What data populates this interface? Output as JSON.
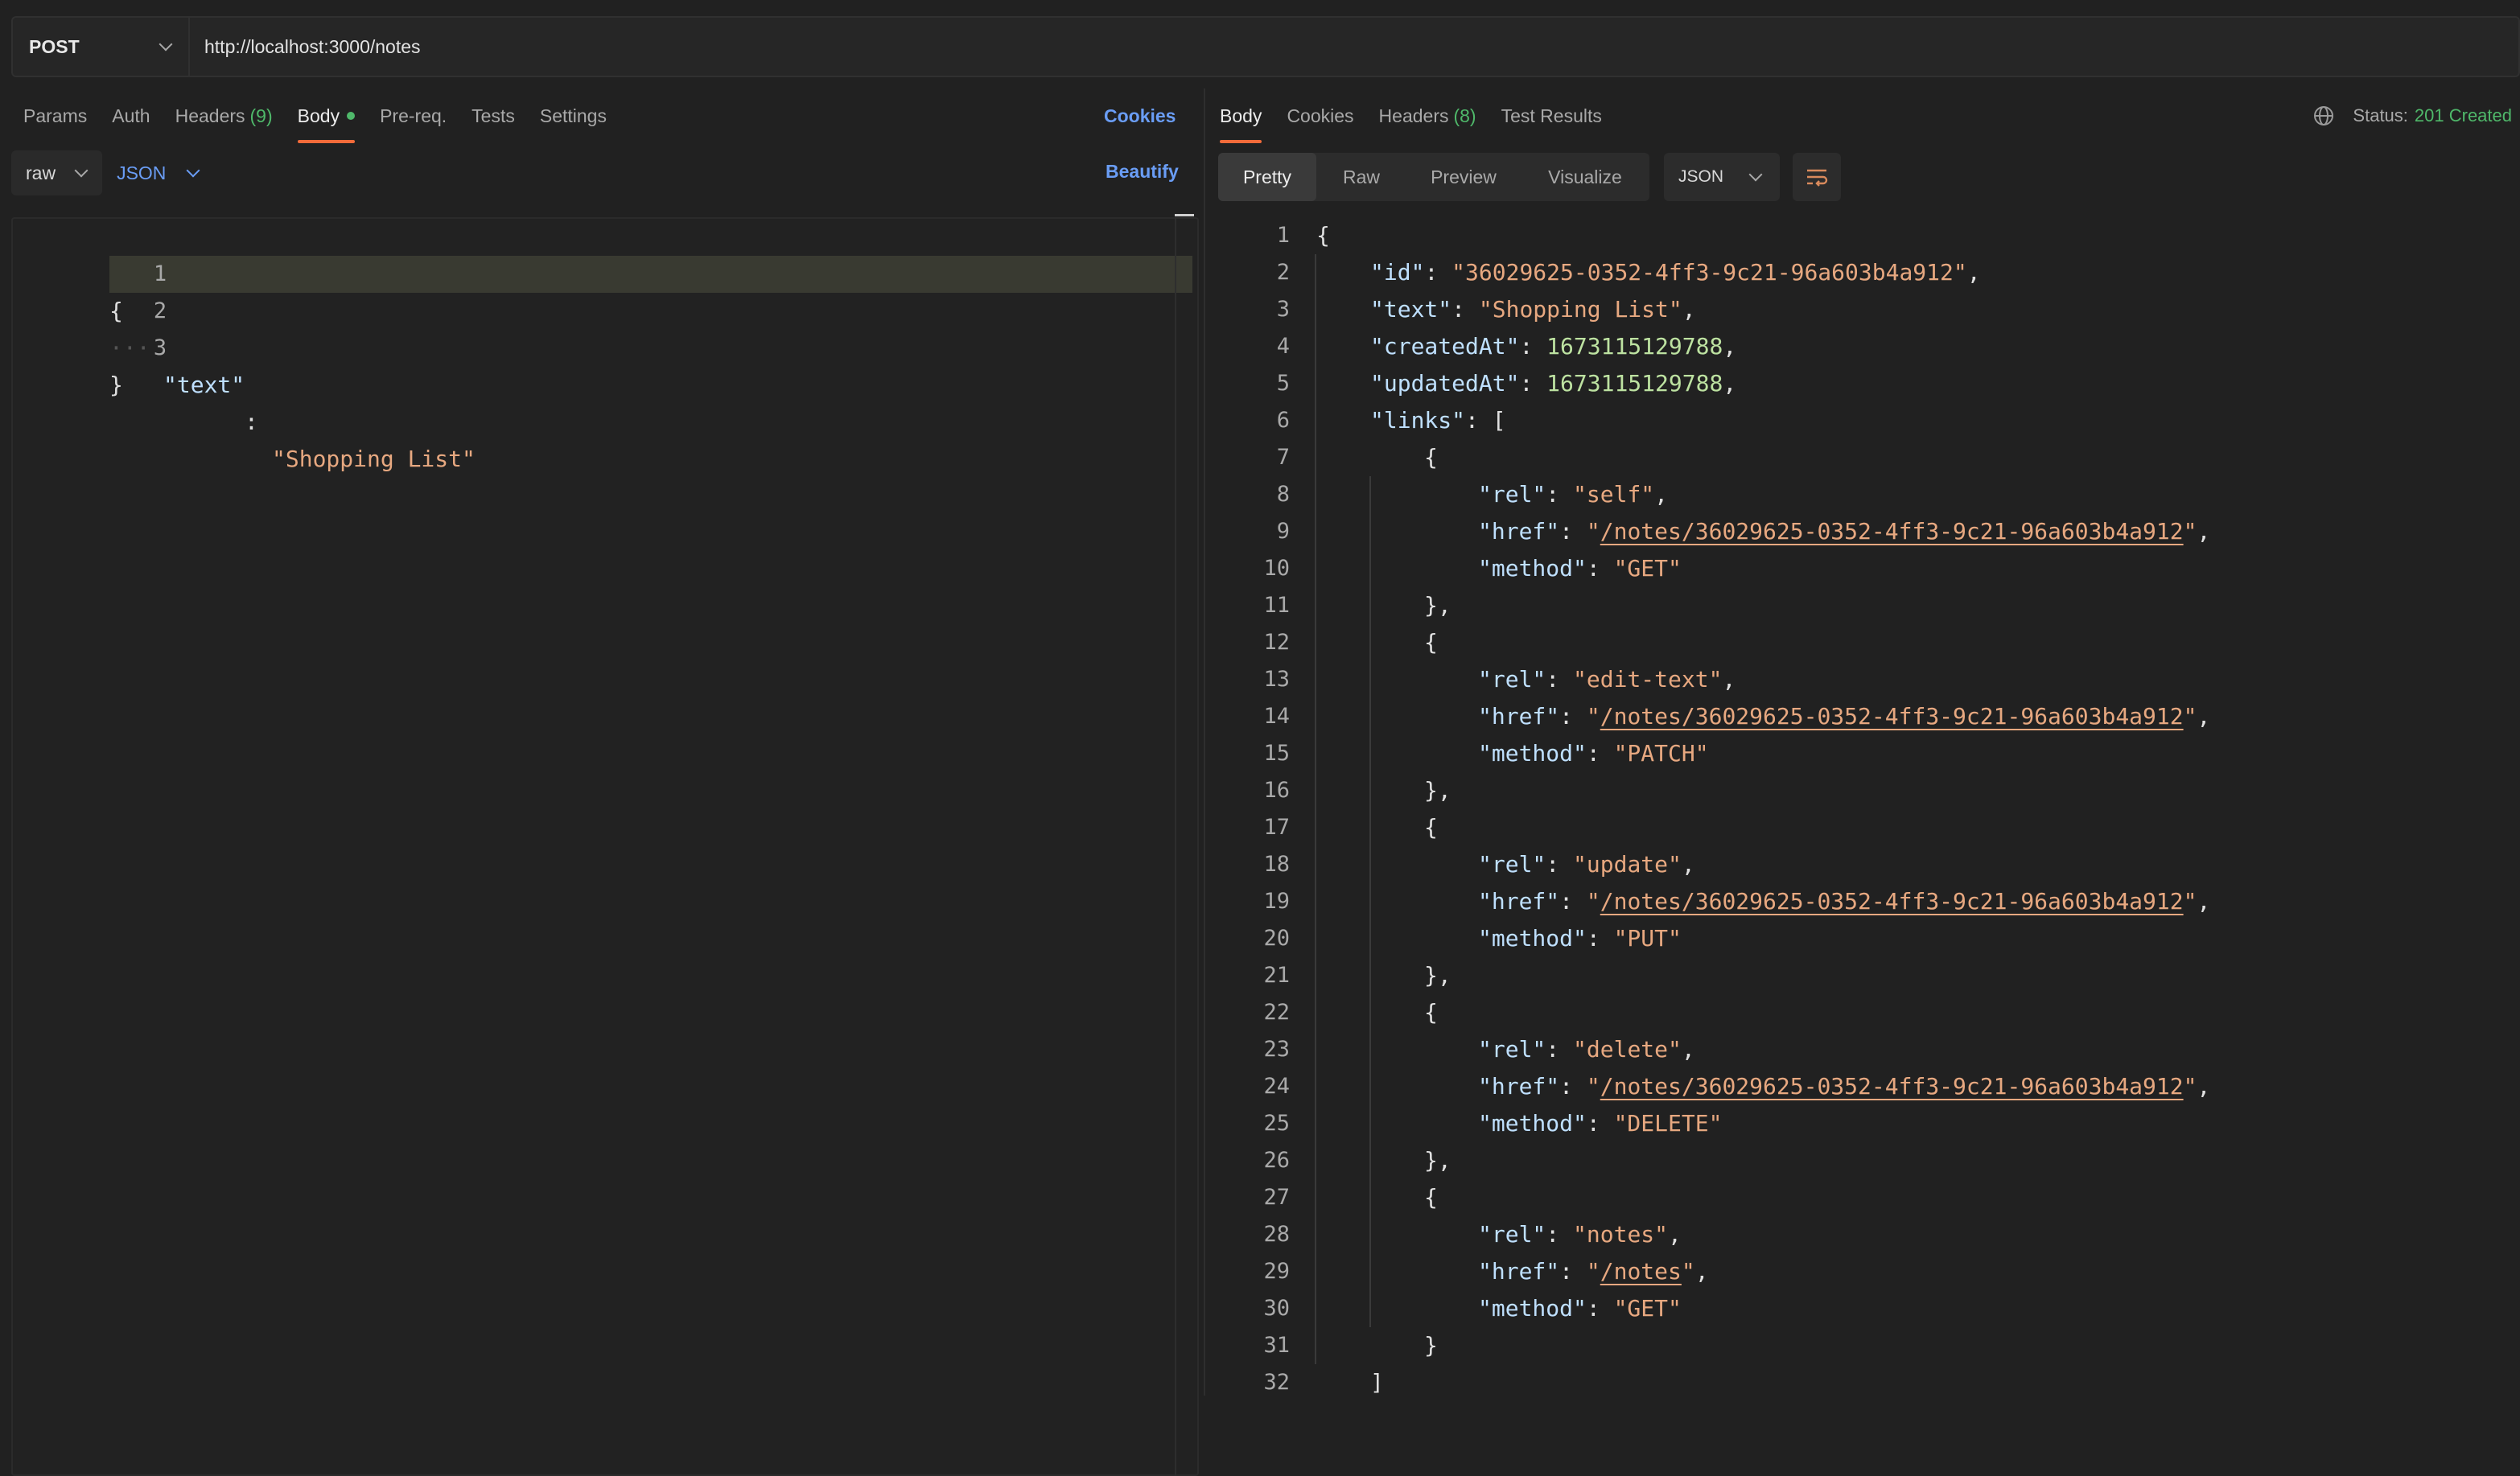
{
  "request": {
    "method": "POST",
    "url": "http://localhost:3000/notes"
  },
  "request_tabs": [
    {
      "label": "Params"
    },
    {
      "label": "Auth"
    },
    {
      "label": "Headers",
      "count": "(9)"
    },
    {
      "label": "Body"
    },
    {
      "label": "Pre-req."
    },
    {
      "label": "Tests"
    },
    {
      "label": "Settings"
    }
  ],
  "cookies_link": "Cookies",
  "body_mode": "raw",
  "body_language": "JSON",
  "beautify_label": "Beautify",
  "request_body_lines": [
    {
      "n": "1",
      "t": "{"
    },
    {
      "n": "2",
      "k": "\"text\"",
      "v": "\"Shopping List\""
    },
    {
      "n": "3",
      "t": "}"
    }
  ],
  "response_tabs": [
    {
      "label": "Body"
    },
    {
      "label": "Cookies"
    },
    {
      "label": "Headers",
      "count": "(8)"
    },
    {
      "label": "Test Results"
    }
  ],
  "status": {
    "label": "Status:",
    "value": "201 Created"
  },
  "view_modes": [
    "Pretty",
    "Raw",
    "Preview",
    "Visualize"
  ],
  "response_format": "JSON",
  "response_lines": [
    {
      "n": "1",
      "parts": [
        [
          "punc",
          "{"
        ]
      ]
    },
    {
      "n": "2",
      "parts": [
        [
          "key",
          "\"id\""
        ],
        [
          "punc",
          ": "
        ],
        [
          "str",
          "\"36029625-0352-4ff3-9c21-96a603b4a912\""
        ],
        [
          "punc",
          ","
        ]
      ]
    },
    {
      "n": "3",
      "parts": [
        [
          "key",
          "\"text\""
        ],
        [
          "punc",
          ": "
        ],
        [
          "str",
          "\"Shopping List\""
        ],
        [
          "punc",
          ","
        ]
      ]
    },
    {
      "n": "4",
      "parts": [
        [
          "key",
          "\"createdAt\""
        ],
        [
          "punc",
          ": "
        ],
        [
          "num",
          "1673115129788"
        ],
        [
          "punc",
          ","
        ]
      ]
    },
    {
      "n": "5",
      "parts": [
        [
          "key",
          "\"updatedAt\""
        ],
        [
          "punc",
          ": "
        ],
        [
          "num",
          "1673115129788"
        ],
        [
          "punc",
          ","
        ]
      ]
    },
    {
      "n": "6",
      "parts": [
        [
          "key",
          "\"links\""
        ],
        [
          "punc",
          ": ["
        ]
      ]
    },
    {
      "n": "7",
      "parts": [
        [
          "punc",
          "{"
        ]
      ]
    },
    {
      "n": "8",
      "parts": [
        [
          "key",
          "\"rel\""
        ],
        [
          "punc",
          ": "
        ],
        [
          "str",
          "\"self\""
        ],
        [
          "punc",
          ","
        ]
      ]
    },
    {
      "n": "9",
      "parts": [
        [
          "key",
          "\"href\""
        ],
        [
          "punc",
          ": "
        ],
        [
          "str",
          "\""
        ],
        [
          "url",
          "/notes/36029625-0352-4ff3-9c21-96a603b4a912"
        ],
        [
          "str",
          "\""
        ],
        [
          "punc",
          ","
        ]
      ]
    },
    {
      "n": "10",
      "parts": [
        [
          "key",
          "\"method\""
        ],
        [
          "punc",
          ": "
        ],
        [
          "str",
          "\"GET\""
        ]
      ]
    },
    {
      "n": "11",
      "parts": [
        [
          "punc",
          "},"
        ]
      ]
    },
    {
      "n": "12",
      "parts": [
        [
          "punc",
          "{"
        ]
      ]
    },
    {
      "n": "13",
      "parts": [
        [
          "key",
          "\"rel\""
        ],
        [
          "punc",
          ": "
        ],
        [
          "str",
          "\"edit-text\""
        ],
        [
          "punc",
          ","
        ]
      ]
    },
    {
      "n": "14",
      "parts": [
        [
          "key",
          "\"href\""
        ],
        [
          "punc",
          ": "
        ],
        [
          "str",
          "\""
        ],
        [
          "url",
          "/notes/36029625-0352-4ff3-9c21-96a603b4a912"
        ],
        [
          "str",
          "\""
        ],
        [
          "punc",
          ","
        ]
      ]
    },
    {
      "n": "15",
      "parts": [
        [
          "key",
          "\"method\""
        ],
        [
          "punc",
          ": "
        ],
        [
          "str",
          "\"PATCH\""
        ]
      ]
    },
    {
      "n": "16",
      "parts": [
        [
          "punc",
          "},"
        ]
      ]
    },
    {
      "n": "17",
      "parts": [
        [
          "punc",
          "{"
        ]
      ]
    },
    {
      "n": "18",
      "parts": [
        [
          "key",
          "\"rel\""
        ],
        [
          "punc",
          ": "
        ],
        [
          "str",
          "\"update\""
        ],
        [
          "punc",
          ","
        ]
      ]
    },
    {
      "n": "19",
      "parts": [
        [
          "key",
          "\"href\""
        ],
        [
          "punc",
          ": "
        ],
        [
          "str",
          "\""
        ],
        [
          "url",
          "/notes/36029625-0352-4ff3-9c21-96a603b4a912"
        ],
        [
          "str",
          "\""
        ],
        [
          "punc",
          ","
        ]
      ]
    },
    {
      "n": "20",
      "parts": [
        [
          "key",
          "\"method\""
        ],
        [
          "punc",
          ": "
        ],
        [
          "str",
          "\"PUT\""
        ]
      ]
    },
    {
      "n": "21",
      "parts": [
        [
          "punc",
          "},"
        ]
      ]
    },
    {
      "n": "22",
      "parts": [
        [
          "punc",
          "{"
        ]
      ]
    },
    {
      "n": "23",
      "parts": [
        [
          "key",
          "\"rel\""
        ],
        [
          "punc",
          ": "
        ],
        [
          "str",
          "\"delete\""
        ],
        [
          "punc",
          ","
        ]
      ]
    },
    {
      "n": "24",
      "parts": [
        [
          "key",
          "\"href\""
        ],
        [
          "punc",
          ": "
        ],
        [
          "str",
          "\""
        ],
        [
          "url",
          "/notes/36029625-0352-4ff3-9c21-96a603b4a912"
        ],
        [
          "str",
          "\""
        ],
        [
          "punc",
          ","
        ]
      ]
    },
    {
      "n": "25",
      "parts": [
        [
          "key",
          "\"method\""
        ],
        [
          "punc",
          ": "
        ],
        [
          "str",
          "\"DELETE\""
        ]
      ]
    },
    {
      "n": "26",
      "parts": [
        [
          "punc",
          "},"
        ]
      ]
    },
    {
      "n": "27",
      "parts": [
        [
          "punc",
          "{"
        ]
      ]
    },
    {
      "n": "28",
      "parts": [
        [
          "key",
          "\"rel\""
        ],
        [
          "punc",
          ": "
        ],
        [
          "str",
          "\"notes\""
        ],
        [
          "punc",
          ","
        ]
      ]
    },
    {
      "n": "29",
      "parts": [
        [
          "key",
          "\"href\""
        ],
        [
          "punc",
          ": "
        ],
        [
          "str",
          "\""
        ],
        [
          "url",
          "/notes"
        ],
        [
          "str",
          "\""
        ],
        [
          "punc",
          ","
        ]
      ]
    },
    {
      "n": "30",
      "parts": [
        [
          "key",
          "\"method\""
        ],
        [
          "punc",
          ": "
        ],
        [
          "str",
          "\"GET\""
        ]
      ]
    },
    {
      "n": "31",
      "parts": [
        [
          "punc",
          "}"
        ]
      ]
    },
    {
      "n": "32",
      "parts": [
        [
          "punc",
          "]"
        ]
      ]
    }
  ],
  "icons": {
    "method_dropdown": "chevron-down-icon",
    "status": "globe-icon",
    "wrap": "wrap-lines-icon"
  },
  "colors": {
    "accent": "#f26b3a",
    "link": "#6a9df5",
    "success": "#4fb86a"
  }
}
